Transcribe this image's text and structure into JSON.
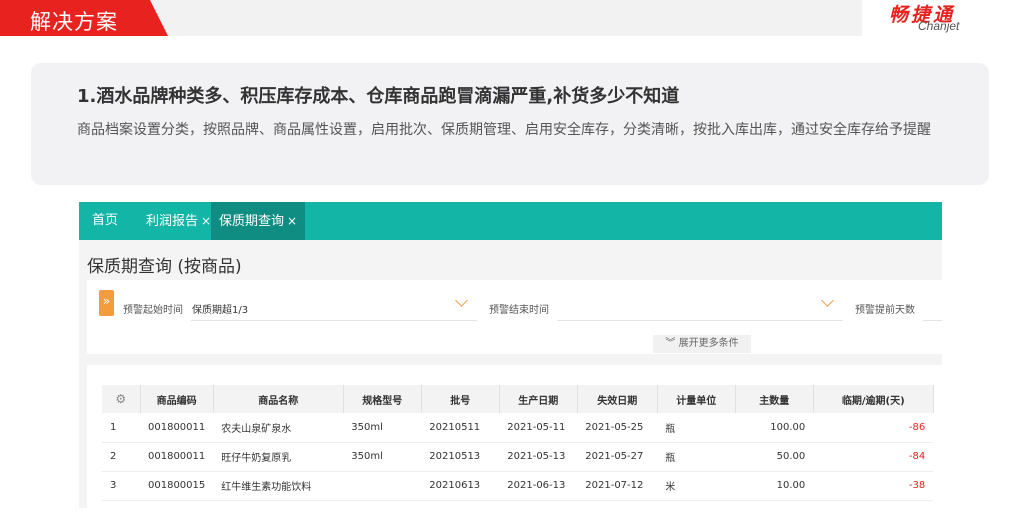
{
  "header": {
    "title": "解决方案",
    "logo_cn": "畅捷通",
    "logo_en": "Chanjet"
  },
  "problem": {
    "title": "1.酒水品牌种类多、积压库存成本、仓库商品跑冒滴漏严重,补货多少不知道",
    "description": "商品档案设置分类，按照品牌、商品属性设置，启用批次、保质期管理、启用安全库存，分类清晰，按批入库出库，通过安全库存给予提醒"
  },
  "app": {
    "tabs": [
      {
        "label": "首页",
        "closable": false,
        "active": false
      },
      {
        "label": "利润报告",
        "closable": true,
        "active": false
      },
      {
        "label": "保质期查询",
        "closable": true,
        "active": true
      }
    ],
    "close_glyph": "×",
    "page_title": "保质期查询 (按商品)",
    "filters": {
      "expand_glyph": "»",
      "start_label": "预警起始时间",
      "start_value": "保质期超1/3",
      "end_label": "预警结束时间",
      "end_value": "",
      "advance_label": "预警提前天数",
      "more_conditions": "︾ 展开更多条件"
    },
    "table": {
      "settings_icon": "gear-icon",
      "columns": [
        "商品编码",
        "商品名称",
        "规格型号",
        "批号",
        "生产日期",
        "失效日期",
        "计量单位",
        "主数量",
        "临期/逾期(天)"
      ],
      "rows": [
        {
          "idx": "1",
          "code": "001800011",
          "name": "农夫山泉矿泉水",
          "spec": "350ml",
          "batch": "20210511",
          "mfg": "2021-05-11",
          "exp": "2021-05-25",
          "unit": "瓶",
          "qty": "100.00",
          "days": "-86"
        },
        {
          "idx": "2",
          "code": "001800011",
          "name": "旺仔牛奶复原乳",
          "spec": "350ml",
          "batch": "20210513",
          "mfg": "2021-05-13",
          "exp": "2021-05-27",
          "unit": "瓶",
          "qty": "50.00",
          "days": "-84"
        },
        {
          "idx": "3",
          "code": "001800015",
          "name": "红牛维生素功能饮料",
          "spec": "",
          "batch": "20210613",
          "mfg": "2021-06-13",
          "exp": "2021-07-12",
          "unit": "米",
          "qty": "10.00",
          "days": "-38"
        }
      ]
    }
  },
  "colors": {
    "brand_red": "#e8231f",
    "teal": "#13b5a6",
    "teal_dark": "#0f8d82",
    "orange": "#f39c3c"
  }
}
